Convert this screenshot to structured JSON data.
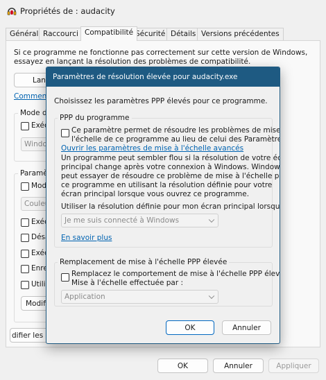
{
  "window": {
    "title": "Propriétés de : audacity",
    "tabs": [
      "Général",
      "Raccourci",
      "Compatibilité",
      "Sécurité",
      "Détails",
      "Versions précédentes"
    ],
    "intro_line1": "Si ce programme ne fonctionne pas correctement sur cette version de Windows,",
    "intro_line2": "essayez en lançant la résolution des problèmes de compatibilité.",
    "launch_button_partial": "Lanc",
    "comment_link_partial": "Comment",
    "mode_group_partial": "Mode d",
    "mode_check_partial": "Exéc",
    "mode_select_partial": "Windo",
    "settings_group_partial": "Paramè",
    "settings_items_partial": [
      "Modi",
      "Exéc",
      "Désa",
      "Exéc",
      "Enre",
      "Utilis"
    ],
    "color_select_partial": "Couleu",
    "modify_button_partial": "Modifie",
    "all_users_button_partial": "difier les p",
    "ok": "OK",
    "cancel": "Annuler",
    "apply": "Appliquer"
  },
  "dialog": {
    "title": "Paramètres de résolution élevée pour audacity.exe",
    "instruction": "Choisissez les paramètres PPP élevés pour ce programme.",
    "ppp_group": {
      "legend": "PPP du programme",
      "checkbox_line1": "Ce paramètre permet de résoudre les problèmes de mise à",
      "checkbox_line2": "l'échelle de ce programme au lieu de celui des Paramètres",
      "link": "Ouvrir les paramètres de mise à l'échelle avancés",
      "desc_lines": [
        "Un programme peut sembler flou si la résolution de votre écran",
        "principal change après votre connexion à Windows. Windows",
        "peut essayer de résoudre ce problème de mise à l'échelle pour",
        "ce programme en utilisant la résolution définie pour votre",
        "écran principal lorsque vous ouvrez ce programme."
      ],
      "select_label": "Utiliser la résolution définie pour mon écran principal lorsque",
      "select_value": "Je me suis connecté à Windows",
      "learn_more": "En savoir plus"
    },
    "override_group": {
      "legend": "Remplacement de mise à l'échelle PPP élevée",
      "checkbox_line1": "Remplacez le comportement de mise à l'échelle PPP élevée.",
      "checkbox_line2": "Mise à l'échelle effectuée par :",
      "select_value": "Application"
    },
    "ok": "OK",
    "cancel": "Annuler"
  },
  "colors": {
    "dialog_title_bar": "#1e5a82",
    "accent": "#0067c0",
    "link": "#0063b1"
  }
}
